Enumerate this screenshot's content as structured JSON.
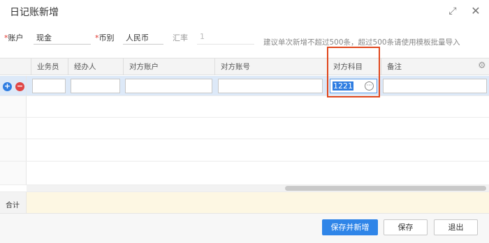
{
  "dialog": {
    "title": "日记账新增",
    "expand_icon": "expand-icon",
    "close_icon": "close-icon"
  },
  "form": {
    "account_label": "账户",
    "account_value": "现金",
    "currency_label": "币别",
    "currency_value": "人民币",
    "rate_label": "汇率",
    "rate_value": "1",
    "required_mark": "*",
    "hint": "建议单次新增不超过500条，超过500条请使用模板批量导入"
  },
  "grid": {
    "columns": [
      "业务员",
      "经办人",
      "对方账户",
      "对方账号",
      "对方科目",
      "备注"
    ],
    "active_row": {
      "salesperson": "",
      "handler": "",
      "counter_account": "",
      "counter_account_no": "",
      "counter_subject": "1221",
      "remark": ""
    },
    "add_row_symbol": "+",
    "delete_row_symbol": "−",
    "more_symbol": "···",
    "settings_icon": "gear-icon"
  },
  "total": {
    "label": "合计"
  },
  "footer": {
    "save_new_label": "保存并新增",
    "save_label": "保存",
    "exit_label": "退出"
  },
  "colors": {
    "primary": "#2f85e8",
    "required": "#e0352c",
    "highlight": "#e0461c",
    "active_row": "#dde9f8",
    "total_row": "#fdf7e3"
  }
}
